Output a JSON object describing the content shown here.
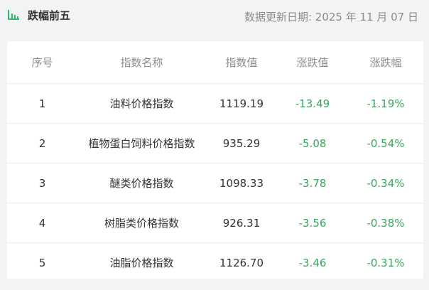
{
  "header": {
    "title": "跌幅前五",
    "date_text": "数据更新日期: 2025 年 11 月 07 日",
    "icon": "bar-chart-icon",
    "accent_color": "#2eb872"
  },
  "table": {
    "columns": [
      "序号",
      "指数名称",
      "指数值",
      "涨跌值",
      "涨跌幅"
    ],
    "rows": [
      {
        "rank": "1",
        "name": "油料价格指数",
        "value": "1119.19",
        "change": "-13.49",
        "pct": "-1.19%"
      },
      {
        "rank": "2",
        "name": "植物蛋白饲料价格指数",
        "value": "935.29",
        "change": "-5.08",
        "pct": "-0.54%"
      },
      {
        "rank": "3",
        "name": "醚类价格指数",
        "value": "1098.33",
        "change": "-3.78",
        "pct": "-0.34%"
      },
      {
        "rank": "4",
        "name": "树脂类价格指数",
        "value": "926.31",
        "change": "-3.56",
        "pct": "-0.38%"
      },
      {
        "rank": "5",
        "name": "油脂价格指数",
        "value": "1126.70",
        "change": "-3.46",
        "pct": "-0.31%"
      }
    ],
    "down_color": "#3aa45f"
  }
}
